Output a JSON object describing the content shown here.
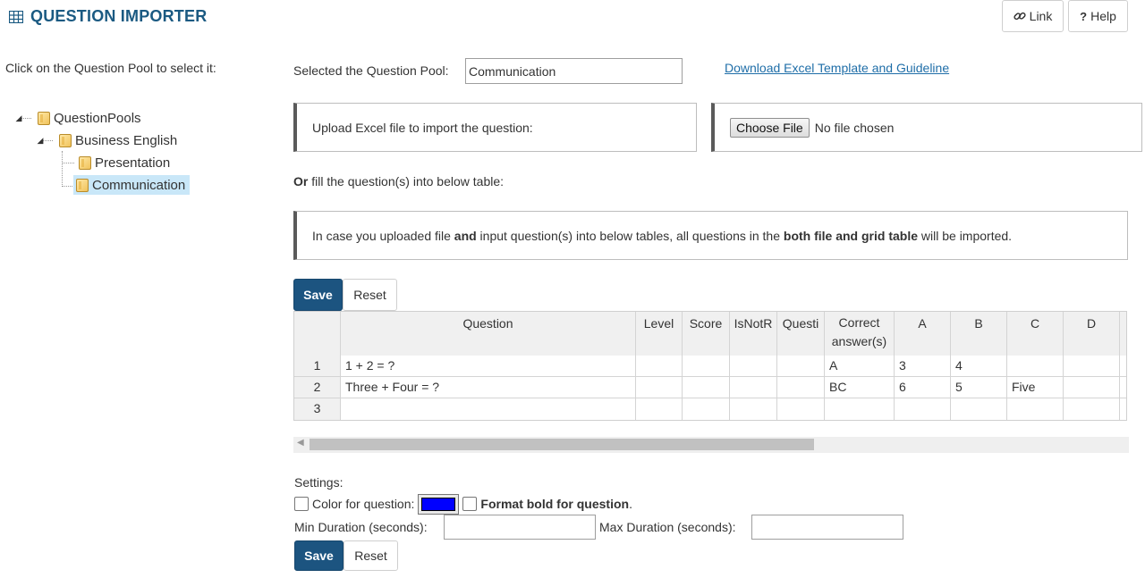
{
  "header": {
    "title": "QUESTION IMPORTER",
    "link_label": "Link",
    "help_label": "Help",
    "help_glyph": "?"
  },
  "tree": {
    "prompt": "Click on the Question Pool to select it:",
    "nodes": [
      {
        "label": "QuestionPools"
      },
      {
        "label": "Business English"
      },
      {
        "label": "Presentation"
      },
      {
        "label": "Communication"
      }
    ]
  },
  "main": {
    "selected_pool_label": "Selected the Question Pool:",
    "selected_pool_value": "Communication",
    "download_link": "Download Excel Template and Guideline",
    "upload_label": "Upload Excel file to import the question:",
    "choose_file_label": "Choose File",
    "no_file_text": "No file chosen",
    "or_bold": "Or",
    "or_rest": " fill the question(s) into below table:",
    "info_parts": {
      "p1": "In case you uploaded file ",
      "b1": "and",
      "p2": " input question(s) into below tables, all questions in the ",
      "b2": "both file and grid table",
      "p3": " will be imported."
    },
    "save_label": "Save",
    "reset_label": "Reset"
  },
  "grid": {
    "columns": [
      "Question",
      "Level",
      "Score",
      "IsNotR",
      "Questi",
      "Correct answer(s)",
      "A",
      "B",
      "C",
      "D"
    ],
    "rows": [
      {
        "num": "1",
        "cells": [
          "1 + 2 = ?",
          "",
          "",
          "",
          "",
          "A",
          "3",
          "4",
          "",
          ""
        ]
      },
      {
        "num": "2",
        "cells": [
          "Three + Four = ?",
          "",
          "",
          "",
          "",
          "BC",
          "6",
          "5",
          "Five",
          ""
        ]
      },
      {
        "num": "3",
        "cells": [
          "",
          "",
          "",
          "",
          "",
          "",
          "",
          "",
          "",
          ""
        ]
      }
    ]
  },
  "settings": {
    "title": "Settings:",
    "color_label": "Color for question:",
    "color_value": "#0000ff",
    "bold_label_bold": "Format bold for question",
    "bold_label_rest": ".",
    "min_label": "Min Duration (seconds):",
    "max_label": "Max Duration (seconds):",
    "min_value": "",
    "max_value": ""
  }
}
